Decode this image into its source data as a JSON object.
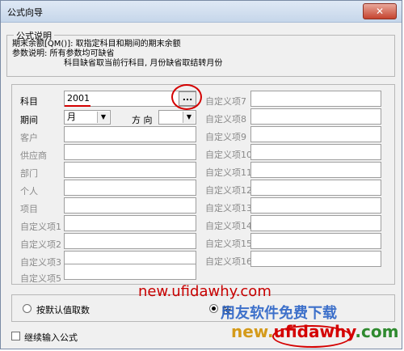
{
  "window": {
    "title": "公式向导",
    "close_glyph": "✕"
  },
  "description": {
    "group_title": "公式说明",
    "line1": "期末余额[QM()]: 取指定科目和期间的期末余额",
    "line2": "参数说明: 所有参数均可缺省",
    "line3": "科目缺省取当前行科目, 月份缺省取结转月份"
  },
  "params": {
    "subject_label": "科目",
    "subject_value": "2001",
    "browse_glyph": "...",
    "period_label": "期间",
    "period_value": "月",
    "direction_label": "方 向",
    "direction_value": "",
    "left_labels": [
      "客户",
      "供应商",
      "部门",
      "个人",
      "项目",
      "自定义项1",
      "自定义项2",
      "自定义项3",
      "自定义项5"
    ],
    "right_labels": [
      "自定义项7",
      "自定义项8",
      "自定义项9",
      "自定义项10",
      "自定义项11",
      "自定义项12",
      "自定义项13",
      "自定义项14",
      "自定义项15",
      "自定义项16"
    ]
  },
  "options": {
    "default_value_label": "按默认值取数",
    "account_value_label": "按"
  },
  "continue_label": "继续输入公式",
  "watermarks": {
    "site": "new.ufidawhy.com",
    "slogan": "用友软件免费下载",
    "site2_part1": "new.",
    "site2_part2": "ufidawhy",
    "site2_part3": ".com"
  },
  "colors": {
    "annotation_red": "#d40000",
    "disabled_text": "#8a8a8a"
  }
}
